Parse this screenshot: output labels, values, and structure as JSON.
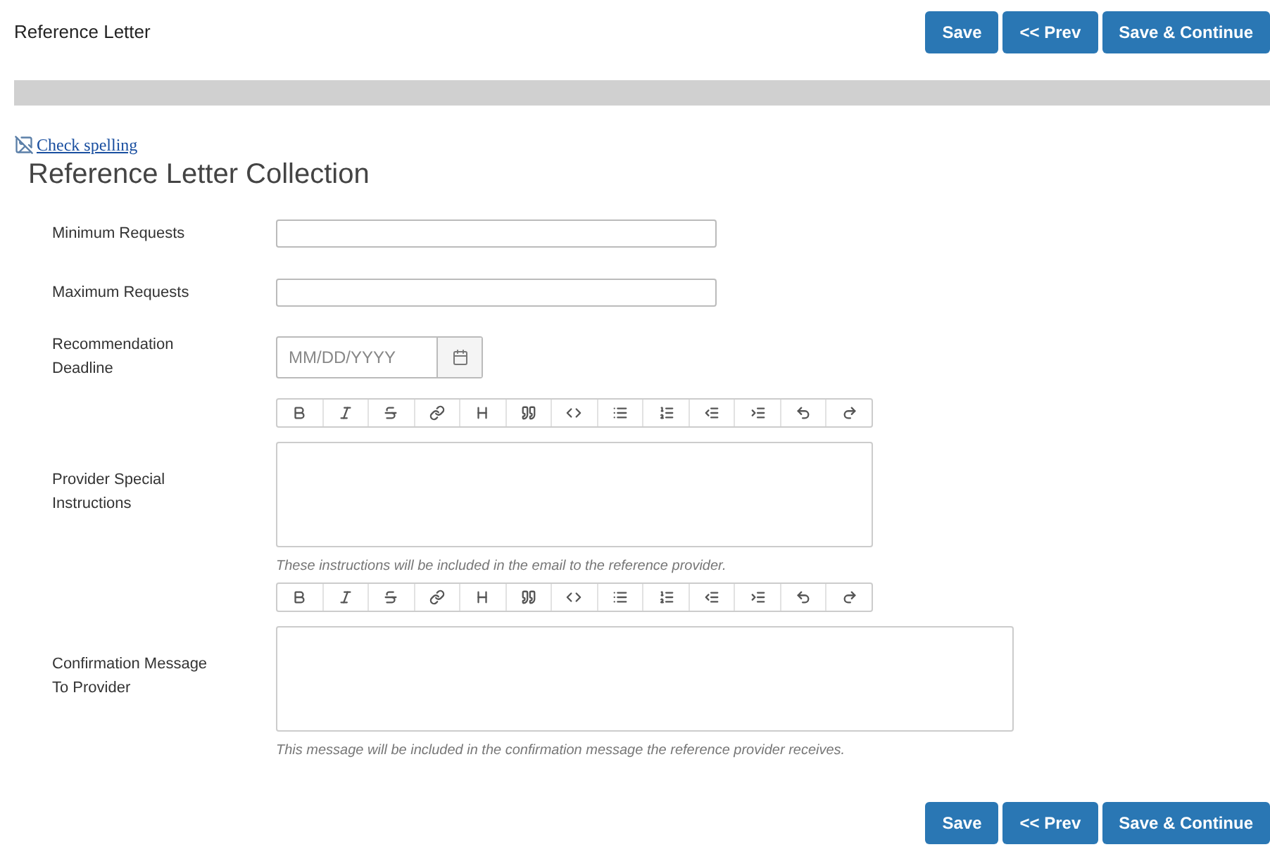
{
  "header": {
    "title": "Reference Letter",
    "buttons": [
      "Save",
      "<< Prev",
      "Save & Continue"
    ]
  },
  "spell_check_link": "Check spelling",
  "section_title": "Reference Letter Collection",
  "fields": [
    {
      "kind": "text",
      "label": "Minimum Requests"
    },
    {
      "kind": "text",
      "label": "Maximum Requests"
    },
    {
      "kind": "date",
      "label": "Recommendation Deadline",
      "placeholder": "MM/DD/YYYY"
    },
    {
      "kind": "editor",
      "label": "Provider Special Instructions",
      "hint": "These instructions will be included in the email to the reference provider."
    },
    {
      "kind": "editor",
      "label": "Confirmation Message To Provider",
      "hint": "This message will be included in the confirmation message the reference provider receives."
    }
  ],
  "footer_buttons": [
    "Save",
    "<< Prev",
    "Save & Continue"
  ]
}
